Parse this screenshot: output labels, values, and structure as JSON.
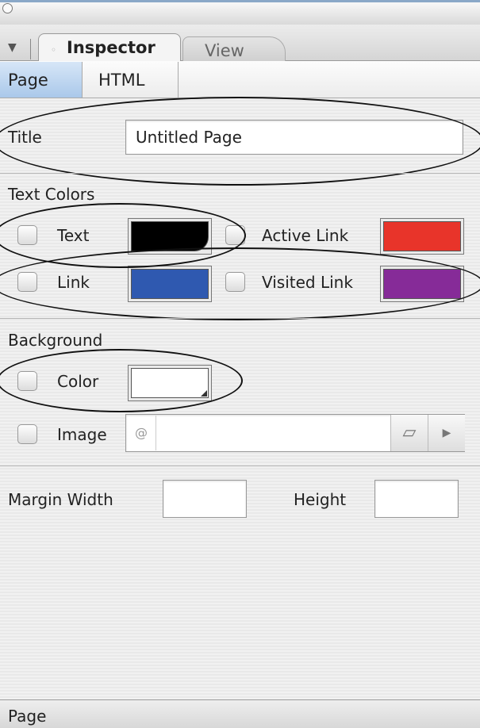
{
  "window": {
    "close_icon": "close-icon"
  },
  "tabs": [
    {
      "label": "Inspector",
      "active": true
    },
    {
      "label": "View",
      "active": false
    }
  ],
  "subtabs": [
    {
      "label": "Page",
      "active": true
    },
    {
      "label": "HTML",
      "active": false
    }
  ],
  "title_section": {
    "label": "Title",
    "value": "Untitled Page"
  },
  "text_colors": {
    "heading": "Text Colors",
    "text": {
      "label": "Text",
      "color": "#000000"
    },
    "active_link": {
      "label": "Active Link",
      "color": "#e8342a"
    },
    "link": {
      "label": "Link",
      "color": "#2f59b0"
    },
    "visited_link": {
      "label": "Visited Link",
      "color": "#862b98"
    }
  },
  "background": {
    "heading": "Background",
    "color": {
      "label": "Color",
      "color": "#ffffff"
    },
    "image": {
      "label": "Image",
      "value": ""
    }
  },
  "margin": {
    "width_label": "Margin Width",
    "width_value": "",
    "height_label": "Height",
    "height_value": ""
  },
  "status": {
    "label": "Page"
  },
  "colors": {
    "accent": "#aac8ea",
    "ellipse": "#111111"
  }
}
